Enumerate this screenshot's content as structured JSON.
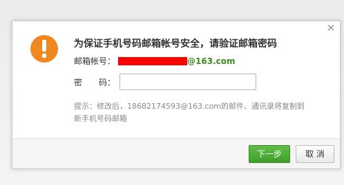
{
  "dialog": {
    "title": "为保证手机号码邮箱帐号安全，请验证邮箱密码",
    "account_label": "邮箱帐号：",
    "account_domain": "@163.com",
    "password_label": "密　　码：",
    "password_value": "",
    "hint": "提示：修改后，18682174593@163.com的邮件、通讯录将复制到新手机号码邮箱",
    "close_symbol": "×",
    "icon": "warning-icon"
  },
  "buttons": {
    "next_label": "下一步",
    "cancel_label": "取 消"
  },
  "colors": {
    "warning_orange": "#f0871f",
    "redaction_red": "#ff0000",
    "domain_green": "#3a8a1c",
    "primary_green": "#4cae33"
  }
}
